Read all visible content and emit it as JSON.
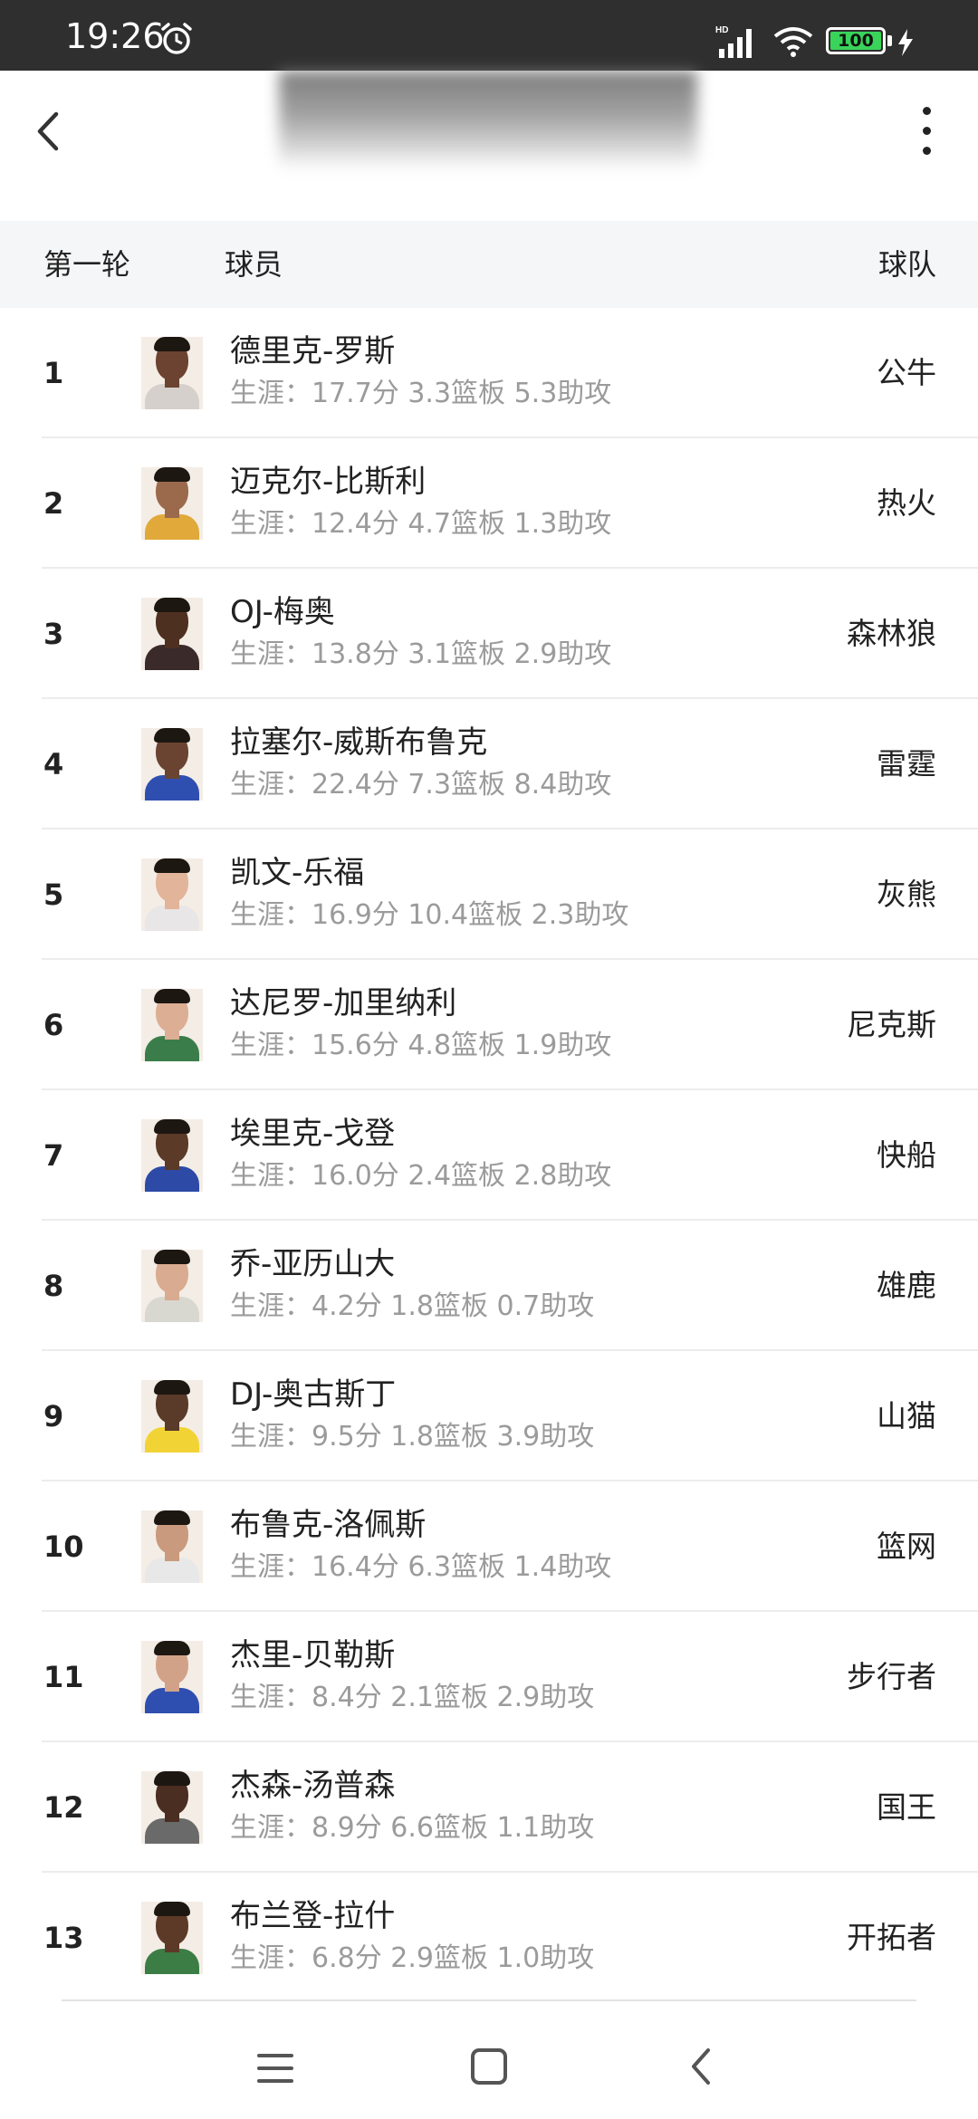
{
  "status_bar": {
    "time": "19:26",
    "battery_level": "100",
    "network_label": "HD",
    "icons": [
      "alarm-icon",
      "signal-icon",
      "wifi-icon",
      "battery-icon",
      "charging-icon"
    ]
  },
  "header": {
    "back_icon": "chevron-left-icon",
    "more_icon": "more-vertical-icon"
  },
  "columns": {
    "round": "第一轮",
    "player": "球员",
    "team": "球队"
  },
  "players": [
    {
      "pick": "1",
      "name": "德里克-罗斯",
      "stats": "生涯：17.7分 3.3篮板 5.3助攻",
      "team": "公牛",
      "skin": "#6b4330",
      "jersey": "#d5d0cc"
    },
    {
      "pick": "2",
      "name": "迈克尔-比斯利",
      "stats": "生涯：12.4分 4.7篮板 1.3助攻",
      "team": "热火",
      "skin": "#9b6a4c",
      "jersey": "#e0a93a"
    },
    {
      "pick": "3",
      "name": "OJ-梅奥",
      "stats": "生涯：13.8分 3.1篮板 2.9助攻",
      "team": "森林狼",
      "skin": "#4e3021",
      "jersey": "#3a2a2a"
    },
    {
      "pick": "4",
      "name": "拉塞尔-威斯布鲁克",
      "stats": "生涯：22.4分 7.3篮板 8.4助攻",
      "team": "雷霆",
      "skin": "#6a4431",
      "jersey": "#2f4fb0"
    },
    {
      "pick": "5",
      "name": "凯文-乐福",
      "stats": "生涯：16.9分 10.4篮板 2.3助攻",
      "team": "灰熊",
      "skin": "#e2b49a",
      "jersey": "#e8e6e6"
    },
    {
      "pick": "6",
      "name": "达尼罗-加里纳利",
      "stats": "生涯：15.6分 4.8篮板 1.9助攻",
      "team": "尼克斯",
      "skin": "#dcae94",
      "jersey": "#3b7d4a"
    },
    {
      "pick": "7",
      "name": "埃里克-戈登",
      "stats": "生涯：16.0分 2.4篮板 2.8助攻",
      "team": "快船",
      "skin": "#5b3a28",
      "jersey": "#2d4aa6"
    },
    {
      "pick": "8",
      "name": "乔-亚历山大",
      "stats": "生涯：4.2分 1.8篮板 0.7助攻",
      "team": "雄鹿",
      "skin": "#d9ab90",
      "jersey": "#d8d8d0"
    },
    {
      "pick": "9",
      "name": "DJ-奥古斯丁",
      "stats": "生涯：9.5分 1.8篮板 3.9助攻",
      "team": "山猫",
      "skin": "#5a3a28",
      "jersey": "#f2d335"
    },
    {
      "pick": "10",
      "name": "布鲁克-洛佩斯",
      "stats": "生涯：16.4分 6.3篮板 1.4助攻",
      "team": "篮网",
      "skin": "#c99a7d",
      "jersey": "#e8e8e8"
    },
    {
      "pick": "11",
      "name": "杰里-贝勒斯",
      "stats": "生涯：8.4分 2.1篮板 2.9助攻",
      "team": "步行者",
      "skin": "#d2a288",
      "jersey": "#2f4fb0"
    },
    {
      "pick": "12",
      "name": "杰森-汤普森",
      "stats": "生涯：8.9分 6.6篮板 1.1助攻",
      "team": "国王",
      "skin": "#4a2e21",
      "jersey": "#6a6a6a"
    },
    {
      "pick": "13",
      "name": "布兰登-拉什",
      "stats": "生涯：6.8分 2.9篮板 1.0助攻",
      "team": "开拓者",
      "skin": "#5d3a27",
      "jersey": "#3c7d45"
    }
  ],
  "nav": {
    "icons": [
      "menu-icon",
      "home-icon",
      "back-icon"
    ]
  }
}
